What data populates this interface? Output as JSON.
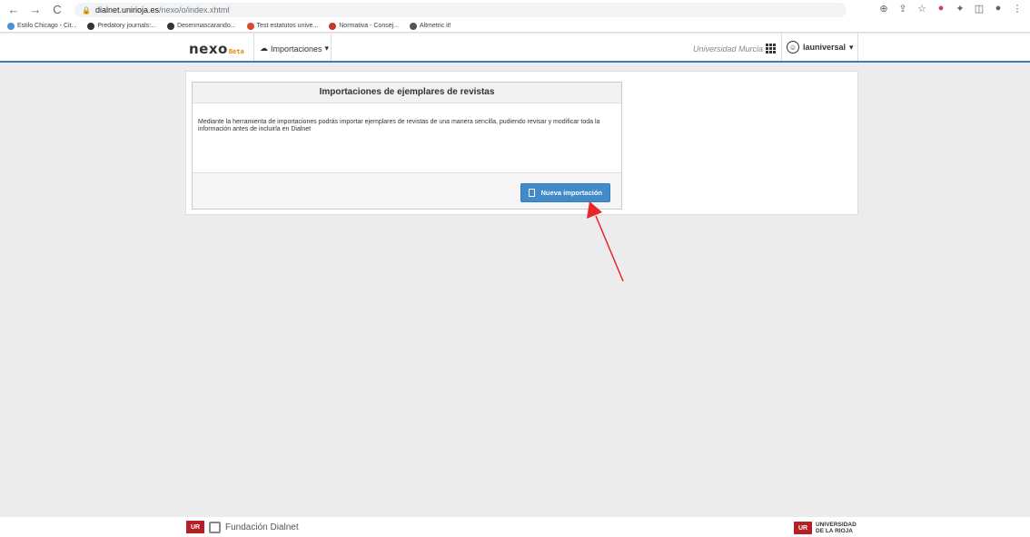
{
  "browser": {
    "nav": {
      "back": "←",
      "forward": "→",
      "reload": "C"
    },
    "url_host": "dialnet.unirioja.es",
    "url_path": "/nexo/o/index.xhtml",
    "right_icons": [
      "⊕",
      "⇪",
      "☆",
      "●",
      "✦",
      "◫",
      "●",
      "⋮"
    ]
  },
  "bookmarks": [
    {
      "label": "Estilo Chicago - Cit...",
      "color": "#4a90d9"
    },
    {
      "label": "Predatory journals:...",
      "color": "#333333"
    },
    {
      "label": "Desenmascarando...",
      "color": "#333333"
    },
    {
      "label": "Test estatutos unive...",
      "color": "#d9482b"
    },
    {
      "label": "Normativa - Consej...",
      "color": "#c0392b"
    },
    {
      "label": "Altmetric it!",
      "color": "#555555"
    }
  ],
  "appbar": {
    "logo": "nexo",
    "logo_beta": "Beta",
    "imports_menu": "Importaciones",
    "university": "Universidad Murcia",
    "user": "launiversal"
  },
  "panel": {
    "title": "Importaciones de ejemplares de revistas",
    "description": "Mediante la herramienta de importaciones podrás importar ejemplares de revistas de una manera sencilla, pudiendo revisar y modificar toda la información antes de incluirla en Dialnet",
    "button": "Nueva importación"
  },
  "footer": {
    "fundacion": "Fundación Dialnet",
    "univ_line1": "UNIVERSIDAD",
    "univ_line2": "DE LA RIOJA",
    "mark": "UR"
  },
  "colors": {
    "accent": "#3f7bbf",
    "button": "#428bca",
    "annotation": "#e8262a"
  }
}
